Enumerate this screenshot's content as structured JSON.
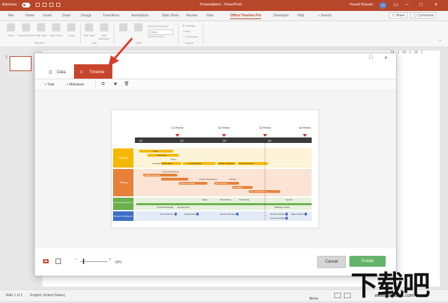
{
  "window": {
    "autosave_label": "AutoSave",
    "autosave_state": "Off",
    "title": "Presentation1  -  PowerPoint",
    "user_name": "Yousaf Hussain",
    "user_initials": "YH"
  },
  "ribbon_tabs": [
    "File",
    "Home",
    "Insert",
    "Draw",
    "Design",
    "Transitions",
    "Animations",
    "Slide Show",
    "Review",
    "View",
    "Office Timeline Pro",
    "Developer",
    "Help",
    "Search"
  ],
  "ribbon_active_tab": "Office Timeline Pro",
  "share_label": "Share",
  "comments_label": "Comments",
  "ribbon": {
    "buttons": [
      "New",
      "Import Export",
      "Edit Data",
      "Style Pane",
      "Copy",
      "Timeline",
      "Add Task",
      "Add Milestone"
    ],
    "settings_items": [
      "Settings",
      "Help",
      "Feedback"
    ],
    "group_labels": [
      "Timeline",
      "Edit",
      "Style",
      "Add",
      "Layout"
    ],
    "style_dropdown": "Gagas"
  },
  "slide_panel": {
    "slide_number": "1"
  },
  "ruler": "14 · 1 · 15 · 1 · 16 · 1",
  "dialog": {
    "tabs": {
      "data": "Data",
      "timeline": "Timeline"
    },
    "toolbar": {
      "task": "+ Task",
      "milestone": "+ Milestone"
    },
    "zoom_value": "69%",
    "cancel": "Cancel",
    "create": "Create"
  },
  "statusbar": {
    "slide_info": "Slide 1 of 1",
    "language": "English (United States)",
    "notes": "Notes"
  },
  "watermark": {
    "text": "下载吧",
    "url": "www.xiazaiba.com"
  },
  "timeline_preview": {
    "milestones": [
      "Q1 Review",
      "Q2 Review",
      "Q3 Review",
      "Q4 Review"
    ],
    "quarters": [
      "Q1",
      "Q2",
      "Q3",
      "Q4"
    ],
    "swimlanes": [
      {
        "name": "Planning",
        "color": "#f5b800"
      },
      {
        "name": "Testing",
        "color": "#e7813a"
      },
      {
        "name": "Service Development",
        "color": "#6ab04c"
      },
      {
        "name": "Business Intelligence",
        "color": "#3f6fc6"
      }
    ],
    "planning_tasks": [
      "Vision",
      "Objectives",
      "Scope",
      "Develop Project Brief",
      "Create Budget",
      "Create Schedule",
      "Secure Funding"
    ],
    "testing_tasks": [
      "Consumer Survey",
      "Market Research",
      "Product Experience",
      "Review",
      "Business Model",
      "Test Timeline",
      "Evaluation",
      "Go-to-market Plan"
    ],
    "dev_tasks": [
      "Alpha",
      "Private Beta",
      "Public Beta",
      "Launch",
      "Product Roadmap",
      "Development",
      "Release to Web"
    ],
    "bi_tasks": [
      "Service Metrics",
      "Quality Metrics",
      "Service Dashboard",
      "Review Dashboard",
      "Sales Dashboard",
      "Scorecard Metrics"
    ]
  },
  "colors": {
    "accent": "#b7472a",
    "timeline_tab": "#c8442d",
    "create_button": "#66b36b",
    "arrow": "#e03a2c"
  }
}
